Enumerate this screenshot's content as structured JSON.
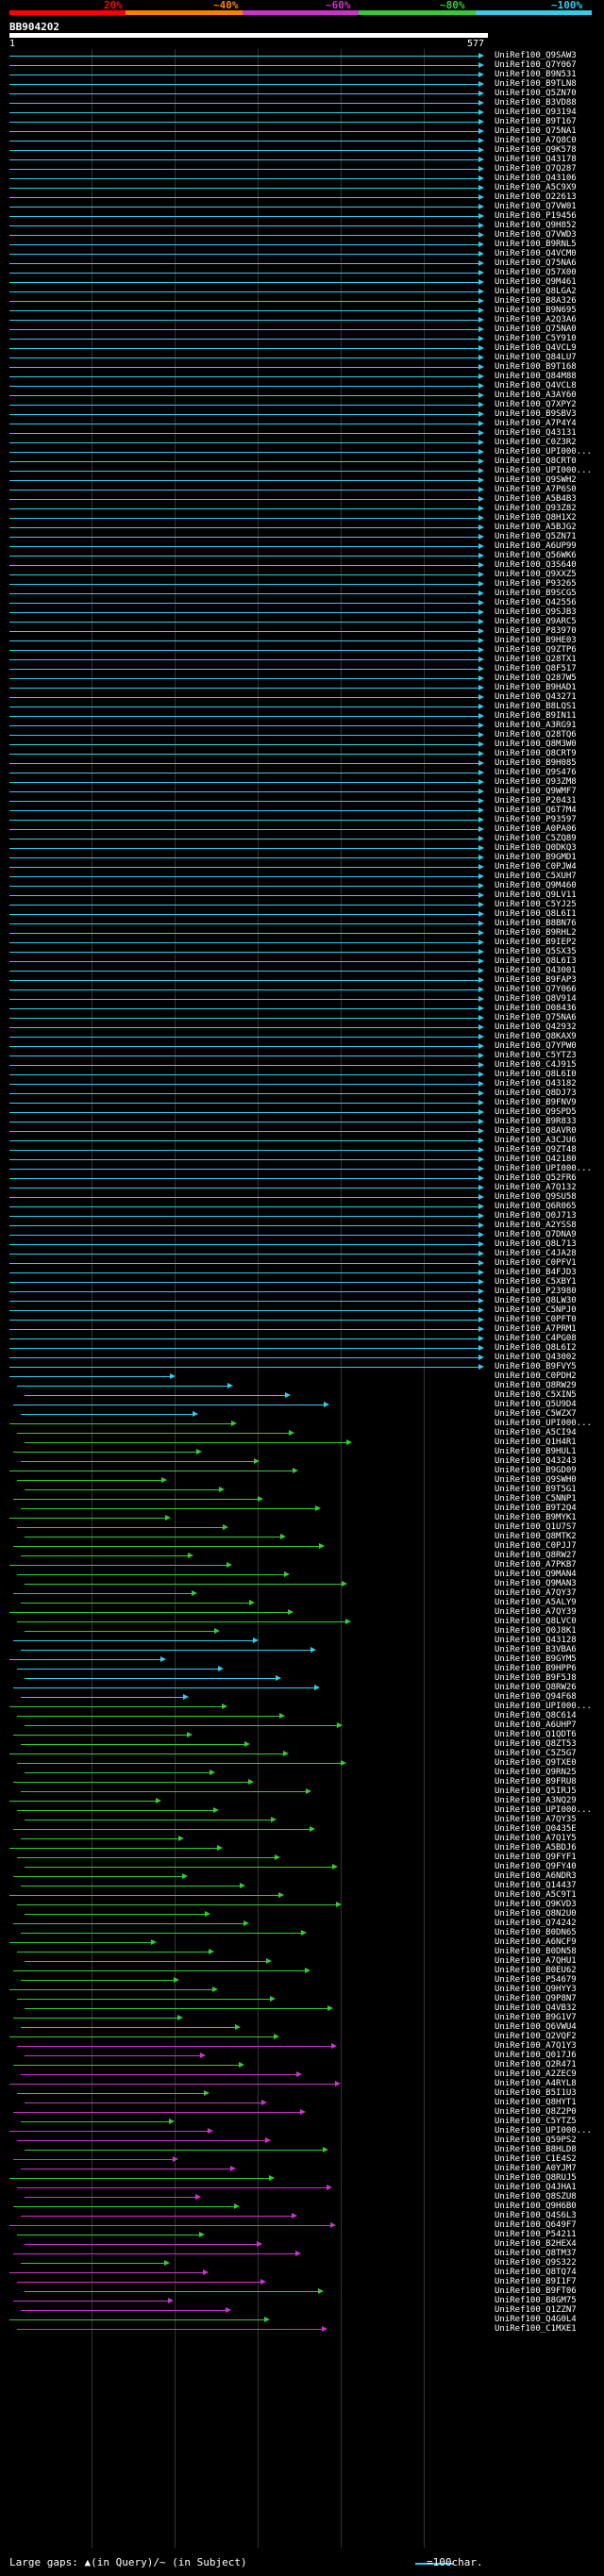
{
  "legend": {
    "labels": [
      "20%",
      "~40%",
      "~60%",
      "~80%",
      "~100%"
    ],
    "colors": [
      "#ff0000",
      "#ff8000",
      "#cc33cc",
      "#33cc33",
      "#33ccee"
    ]
  },
  "query": {
    "id": "BB904202",
    "start_label": "1",
    "end_label": "577",
    "length": 577
  },
  "footer": {
    "gaps_text": "Large gaps: ▲(in Query)/~ (in Subject)",
    "scale_text": "=100char."
  },
  "hits": [
    "UniRef100_Q9SAW3",
    "UniRef100_Q7Y067",
    "UniRef100_B9N531",
    "UniRef100_B9TLN8",
    "UniRef100_Q5ZN70",
    "UniRef100_B3VD88",
    "UniRef100_Q93194",
    "UniRef100_B9T167",
    "UniRef100_Q75NA1",
    "UniRef100_A7Q8C0",
    "UniRef100_Q9K578",
    "UniRef100_Q43178",
    "UniRef100_Q7Q287",
    "UniRef100_Q43106",
    "UniRef100_A5C9X9",
    "UniRef100_O22613",
    "UniRef100_Q7VW01",
    "UniRef100_P19456",
    "UniRef100_Q9H852",
    "UniRef100_Q7VWD3",
    "UniRef100_B9RNL5",
    "UniRef100_Q4VCM0",
    "UniRef100_Q75NA6",
    "UniRef100_Q57X00",
    "UniRef100_Q9M461",
    "UniRef100_Q8LGA2",
    "UniRef100_B8A326",
    "UniRef100_B9N695",
    "UniRef100_A2Q3A6",
    "UniRef100_Q75NA0",
    "UniRef100_C5Y910",
    "UniRef100_Q4VCL9",
    "UniRef100_Q84LU7",
    "UniRef100_B9T168",
    "UniRef100_Q84M88",
    "UniRef100_Q4VCL8",
    "UniRef100_A3AY60",
    "UniRef100_Q7XPY2",
    "UniRef100_B9SBV3",
    "UniRef100_A7P4Y4",
    "UniRef100_Q43131",
    "UniRef100_C0Z3R2",
    "UniRef100_UPI000...",
    "UniRef100_Q8CRT0",
    "UniRef100_UPI000...",
    "UniRef100_Q9SWH2",
    "UniRef100_A7P6S0",
    "UniRef100_A5B4B3",
    "UniRef100_Q93Z82",
    "UniRef100_Q8H1X2",
    "UniRef100_A5BJG2",
    "UniRef100_Q5ZN71",
    "UniRef100_A6UP99",
    "UniRef100_Q56WK6",
    "UniRef100_Q3S640",
    "UniRef100_Q9XXZ5",
    "UniRef100_P93265",
    "UniRef100_B9SCG5",
    "UniRef100_Q42556",
    "UniRef100_Q9SJB3",
    "UniRef100_Q9ARC5",
    "UniRef100_P83970",
    "UniRef100_B9HE03",
    "UniRef100_Q9ZTP6",
    "UniRef100_Q28TX1",
    "UniRef100_Q8F517",
    "UniRef100_Q287W5",
    "UniRef100_B9HAD1",
    "UniRef100_Q43271",
    "UniRef100_B8LQS1",
    "UniRef100_B9IN11",
    "UniRef100_A3RG91",
    "UniRef100_Q28TQ6",
    "UniRef100_Q8M3W0",
    "UniRef100_Q8CRT9",
    "UniRef100_B9H085",
    "UniRef100_Q9S476",
    "UniRef100_Q93ZM8",
    "UniRef100_Q9WMF7",
    "UniRef100_P20431",
    "UniRef100_Q6T7M4",
    "UniRef100_P93597",
    "UniRef100_A0PA06",
    "UniRef100_C5ZQ89",
    "UniRef100_Q0DKQ3",
    "UniRef100_B9GMD1",
    "UniRef100_C0PJW4",
    "UniRef100_C5XUH7",
    "UniRef100_Q9M460",
    "UniRef100_Q9LV11",
    "UniRef100_C5YJ25",
    "UniRef100_Q8L6I1",
    "UniRef100_B8BN76",
    "UniRef100_B9RHL2",
    "UniRef100_B9IEP2",
    "UniRef100_Q5SX35",
    "UniRef100_Q8L6I3",
    "UniRef100_Q43001",
    "UniRef100_B9FAP3",
    "UniRef100_Q7Y066",
    "UniRef100_Q8V914",
    "UniRef100_O08436",
    "UniRef100_Q75NA6",
    "UniRef100_Q42932",
    "UniRef100_Q8KAX9",
    "UniRef100_Q7YPW0",
    "UniRef100_C5YTZ3",
    "UniRef100_C4J915",
    "UniRef100_Q8L6I0",
    "UniRef100_Q43182",
    "UniRef100_Q8DJ73",
    "UniRef100_B9FNV9",
    "UniRef100_Q9SPD5",
    "UniRef100_B9R833",
    "UniRef100_Q8AVR0",
    "UniRef100_A3CJU6",
    "UniRef100_Q9ZT48",
    "UniRef100_Q42180",
    "UniRef100_UPI000...",
    "UniRef100_Q52FR6",
    "UniRef100_A7Q132",
    "UniRef100_Q9SU58",
    "UniRef100_Q6R065",
    "UniRef100_Q0J713",
    "UniRef100_A2YSS8",
    "UniRef100_Q7DNA9",
    "UniRef100_Q8L713",
    "UniRef100_C4JA28",
    "UniRef100_C0PFV1",
    "UniRef100_B4FJD3",
    "UniRef100_C5XBY1",
    "UniRef100_P23980",
    "UniRef100_Q8LW30",
    "UniRef100_C5NPJ0",
    "UniRef100_C0PFT0",
    "UniRef100_A7PRM1",
    "UniRef100_C4PG08",
    "UniRef100_Q8L6I2",
    "UniRef100_Q43002",
    "UniRef100_B9FVY5",
    "UniRef100_C0PDH2",
    "UniRef100_Q8RW29",
    "UniRef100_C5XIN5",
    "UniRef100_Q5U9D4",
    "UniRef100_C5WZX7",
    "UniRef100_UPI000...",
    "UniRef100_A5CI94",
    "UniRef100_Q1H4R1",
    "UniRef100_B9HUL1",
    "UniRef100_Q43243",
    "UniRef100_B9GD09",
    "UniRef100_Q9SWH0",
    "UniRef100_B9T5G1",
    "UniRef100_C5NNP1",
    "UniRef100_B9T2Q4",
    "UniRef100_B9MYK1",
    "UniRef100_Q1U7S7",
    "UniRef100_Q8MTK2",
    "UniRef100_C0PJJ7",
    "UniRef100_Q8RW27",
    "UniRef100_A7PKB7",
    "UniRef100_Q9MAN4",
    "UniRef100_Q9MAN3",
    "UniRef100_A7QY37",
    "UniRef100_A5ALY9",
    "UniRef100_A7QY39",
    "UniRef100_Q8LVC0",
    "UniRef100_Q0J8K1",
    "UniRef100_Q43128",
    "UniRef100_B3VBA6",
    "UniRef100_B9GYM5",
    "UniRef100_B9HPP6",
    "UniRef100_B9F5J8",
    "UniRef100_Q8RW26",
    "UniRef100_Q94F68",
    "UniRef100_UPI000...",
    "UniRef100_Q8C614",
    "UniRef100_A6UHP7",
    "UniRef100_Q1QDT6",
    "UniRef100_Q8ZT53",
    "UniRef100_C5Z5G7",
    "UniRef100_Q9TXE0",
    "UniRef100_Q9RN25",
    "UniRef100_B9FRU8",
    "UniRef100_Q5IRJ5",
    "UniRef100_A3NQ29",
    "UniRef100_UPI000...",
    "UniRef100_A7QY35",
    "UniRef100_Q0435E",
    "UniRef100_A7Q1Y5",
    "UniRef100_A5BDJ6",
    "UniRef100_Q9FYF1",
    "UniRef100_Q9FY40",
    "UniRef100_A6NDR3",
    "UniRef100_Q14437",
    "UniRef100_A5C9T1",
    "UniRef100_Q9KVD3",
    "UniRef100_Q8N2U0",
    "UniRef100_Q74242",
    "UniRef100_B0DN65",
    "UniRef100_A6NCF9",
    "UniRef100_B0DN58",
    "UniRef100_A7QHU1",
    "UniRef100_B0EU62",
    "UniRef100_P54679",
    "UniRef100_Q9HYY3",
    "UniRef100_Q9P8N7",
    "UniRef100_Q4VB32",
    "UniRef100_B9G1V7",
    "UniRef100_Q6VWU4",
    "UniRef100_Q2VQF2",
    "UniRef100_A7Q1Y3",
    "UniRef100_Q017J6",
    "UniRef100_Q2R471",
    "UniRef100_A2ZEC9",
    "UniRef100_A4RYL8",
    "UniRef100_B5I1U3",
    "UniRef100_Q8HYT1",
    "UniRef100_Q8Z2P0",
    "UniRef100_C5YTZ5",
    "UniRef100_UPI000...",
    "UniRef100_Q59PS2",
    "UniRef100_B8HLD8",
    "UniRef100_C1E4S2",
    "UniRef100_A0YJM7",
    "UniRef100_Q8RUJ5",
    "UniRef100_Q4JHA1",
    "UniRef100_Q8SZU8",
    "UniRef100_Q9H6B0",
    "UniRef100_Q4S6L3",
    "UniRef100_Q649F7",
    "UniRef100_P54211",
    "UniRef100_B2HEX4",
    "UniRef100_Q8TM37",
    "UniRef100_Q9S322",
    "UniRef100_Q8TQ74",
    "UniRef100_B9I1F7",
    "UniRef100_B9FT06",
    "UniRef100_B8GM75",
    "UniRef100_Q1ZZN7",
    "UniRef100_Q4G0L4",
    "UniRef100_C1MXE1"
  ]
}
